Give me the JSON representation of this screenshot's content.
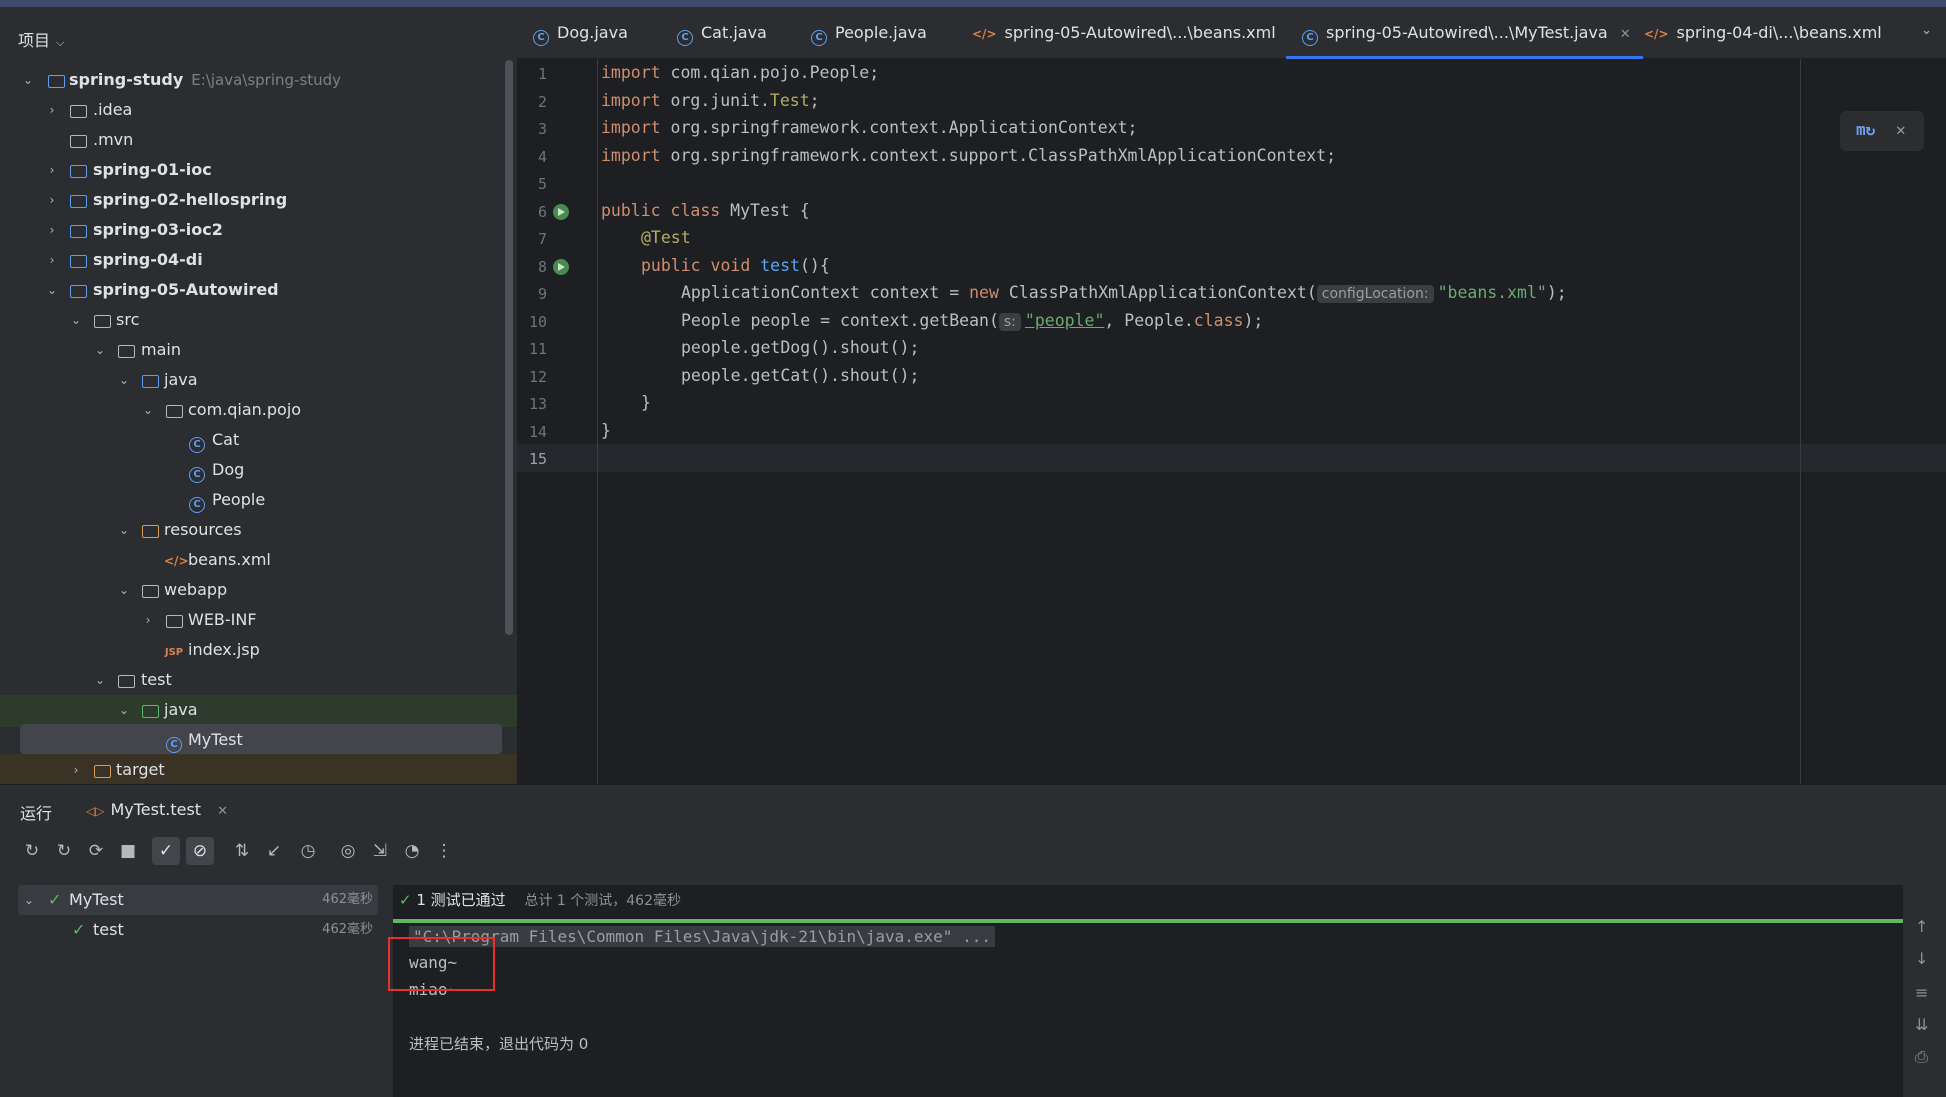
{
  "project_panel": {
    "title": "项目",
    "tree": [
      {
        "label": "spring-study",
        "hint": "E:\\java\\spring-study"
      },
      {
        "label": ".idea"
      },
      {
        "label": ".mvn"
      },
      {
        "label": "spring-01-ioc"
      },
      {
        "label": "spring-02-hellospring"
      },
      {
        "label": "spring-03-ioc2"
      },
      {
        "label": "spring-04-di"
      },
      {
        "label": "spring-05-Autowired"
      },
      {
        "label": "src"
      },
      {
        "label": "main"
      },
      {
        "label": "java"
      },
      {
        "label": "com.qian.pojo"
      },
      {
        "label": "Cat"
      },
      {
        "label": "Dog"
      },
      {
        "label": "People"
      },
      {
        "label": "resources"
      },
      {
        "label": "beans.xml"
      },
      {
        "label": "webapp"
      },
      {
        "label": "WEB-INF"
      },
      {
        "label": "index.jsp"
      },
      {
        "label": "test"
      },
      {
        "label": "java"
      },
      {
        "label": "MyTest"
      },
      {
        "label": "target"
      }
    ]
  },
  "editor_tabs": [
    {
      "label": "Dog.java"
    },
    {
      "label": "Cat.java"
    },
    {
      "label": "People.java"
    },
    {
      "label": "spring-05-Autowired\\...\\beans.xml"
    },
    {
      "label": "spring-05-Autowired\\...\\MyTest.java",
      "active": true
    },
    {
      "label": "spring-04-di\\...\\beans.xml"
    }
  ],
  "editor": {
    "line_numbers": [
      "1",
      "2",
      "3",
      "4",
      "5",
      "6",
      "7",
      "8",
      "9",
      "10",
      "11",
      "12",
      "13",
      "14",
      "15"
    ],
    "code": {
      "l1_kw": "import",
      "l1_rest": " com.qian.pojo.People;",
      "l2_kw": "import",
      "l2_a": " org.junit.",
      "l2_b": "Test",
      "l2_c": ";",
      "l3_kw": "import",
      "l3_rest": " org.springframework.context.ApplicationContext;",
      "l4_kw": "import",
      "l4_rest": " org.springframework.context.support.ClassPathXmlApplicationContext;",
      "l6_kw1": "public",
      "l6_kw2": "class",
      "l6_rest": " MyTest {",
      "l7_an": "@Test",
      "l8_kw1": "public",
      "l8_kw2": "void",
      "l8_fn": "test",
      "l8_rest": "(){",
      "l9_a": "ApplicationContext context = ",
      "l9_kw": "new",
      "l9_b": " ClassPathXmlApplicationContext(",
      "l9_hint": "configLocation:",
      "l9_str": "\"beans.xml\"",
      "l9_c": ");",
      "l10_a": "People people = context.getBean(",
      "l10_hint": "s:",
      "l10_str": "\"people\"",
      "l10_b": ", People.",
      "l10_kw": "class",
      "l10_c": ");",
      "l11": "people.getDog().shout();",
      "l12": "people.getCat().shout();",
      "l13": "}",
      "l14": "}"
    }
  },
  "run_panel": {
    "title": "运行",
    "tab_label": "MyTest.test",
    "tests": [
      {
        "name": "MyTest",
        "time": "462毫秒"
      },
      {
        "name": "test",
        "time": "462毫秒"
      }
    ],
    "status_count": "1 测试已通过",
    "status_summary": "总计 1 个测试，462毫秒",
    "console": {
      "cmd": "\"C:\\Program Files\\Common Files\\Java\\jdk-21\\bin\\java.exe\" ...",
      "out1": "wang~",
      "out2": "miao~",
      "exit": "进程已结束，退出代码为 0"
    }
  },
  "colors": {
    "accent": "#3574f0",
    "success": "#5fb865",
    "highlight_box": "#e8312b"
  }
}
